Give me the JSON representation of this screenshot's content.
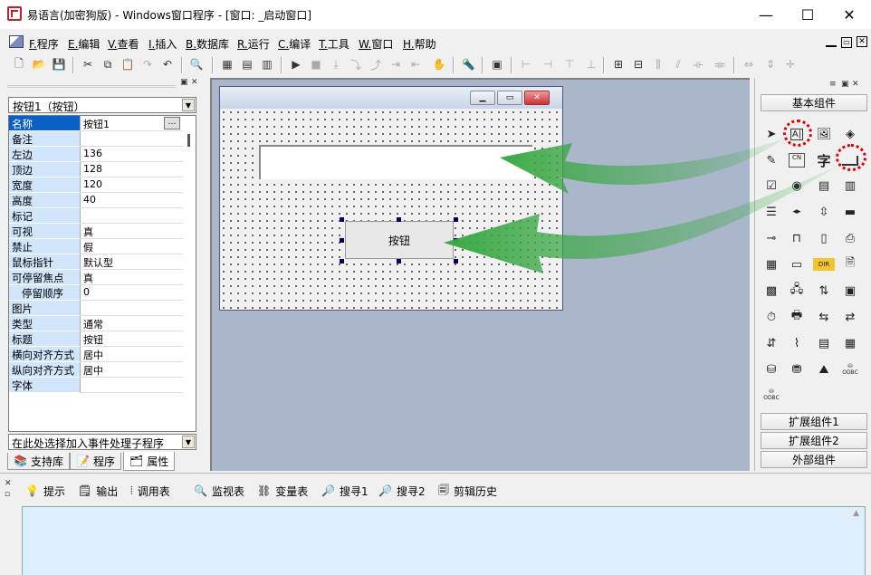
{
  "title": "易语言(加密狗版) - Windows窗口程序 - [窗口: _启动窗口]",
  "window_controls": {
    "minimize": "—",
    "maximize": "☐",
    "close": "✕"
  },
  "menu": [
    {
      "key": "F.",
      "label": "程序"
    },
    {
      "key": "E.",
      "label": "编辑"
    },
    {
      "key": "V.",
      "label": "查看"
    },
    {
      "key": "I.",
      "label": "插入"
    },
    {
      "key": "B.",
      "label": "数据库"
    },
    {
      "key": "R.",
      "label": "运行"
    },
    {
      "key": "C.",
      "label": "编译"
    },
    {
      "key": "T.",
      "label": "工具"
    },
    {
      "key": "W.",
      "label": "窗口"
    },
    {
      "key": "H.",
      "label": "帮助"
    }
  ],
  "object_selector": "按钮1（按钮）",
  "properties": [
    {
      "name": "名称",
      "value": "按钮1"
    },
    {
      "name": "备注",
      "value": ""
    },
    {
      "name": "左边",
      "value": "136"
    },
    {
      "name": "顶边",
      "value": "128"
    },
    {
      "name": "宽度",
      "value": "120"
    },
    {
      "name": "高度",
      "value": "40"
    },
    {
      "name": "标记",
      "value": ""
    },
    {
      "name": "可视",
      "value": "真"
    },
    {
      "name": "禁止",
      "value": "假"
    },
    {
      "name": "鼠标指针",
      "value": "默认型"
    },
    {
      "name": "可停留焦点",
      "value": "真"
    },
    {
      "name": "停留顺序",
      "value": "0"
    },
    {
      "name": "图片",
      "value": ""
    },
    {
      "name": "类型",
      "value": "通常"
    },
    {
      "name": "标题",
      "value": "按钮"
    },
    {
      "name": "横向对齐方式",
      "value": "居中"
    },
    {
      "name": "纵向对齐方式",
      "value": "居中"
    },
    {
      "name": "字体",
      "value": ""
    }
  ],
  "event_selector": "在此处选择加入事件处理子程序",
  "left_tabs": [
    "支持库",
    "程序",
    "属性"
  ],
  "form_button_caption": "按钮",
  "right_panel": {
    "basic": "基本组件",
    "ext1": "扩展组件1",
    "ext2": "扩展组件2",
    "external": "外部组件",
    "tile_char": "字",
    "tile_odbc": "ODBC",
    "tile_dir": "DIR",
    "tile_cn": "CN"
  },
  "bottom_tabs": [
    "提示",
    "输出",
    "调用表",
    "监视表",
    "变量表",
    "搜寻1",
    "搜寻2",
    "剪辑历史"
  ],
  "colors": {
    "selection": "#0a5fc4",
    "prop_key_bg": "#d1e6fb",
    "arrow": "#3aa844",
    "highlight": "#dd0000"
  }
}
